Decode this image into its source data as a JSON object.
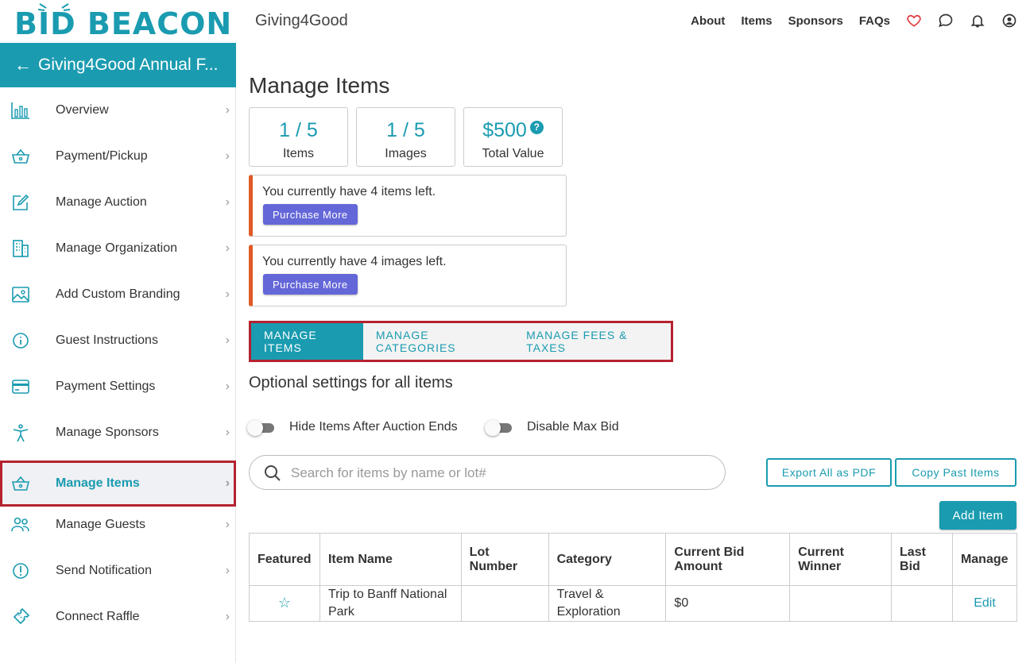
{
  "brand": {
    "logo_text": "BID BEACON",
    "accent": "#1a9bb0",
    "alert": "#e05a24",
    "purchase": "#6467d8",
    "highlight": "#b52230"
  },
  "header": {
    "org_name": "Giving4Good",
    "nav": [
      "About",
      "Items",
      "Sponsors",
      "FAQs"
    ],
    "icons": [
      "heart-icon",
      "chat-icon",
      "bell-icon",
      "account-icon"
    ]
  },
  "sidebar": {
    "back_title": "Giving4Good Annual F...",
    "items": [
      {
        "label": "Overview",
        "icon": "bar-chart-icon"
      },
      {
        "label": "Payment/Pickup",
        "icon": "basket-icon"
      },
      {
        "label": "Manage Auction",
        "icon": "edit-icon"
      },
      {
        "label": "Manage Organization",
        "icon": "building-icon"
      },
      {
        "label": "Add Custom Branding",
        "icon": "image-icon"
      },
      {
        "label": "Guest Instructions",
        "icon": "info-icon"
      },
      {
        "label": "Payment Settings",
        "icon": "credit-card-icon"
      },
      {
        "label": "Manage Sponsors",
        "icon": "person-icon"
      },
      {
        "label": "Manage Items",
        "icon": "basket-icon",
        "active": true
      },
      {
        "label": "Manage Guests",
        "icon": "users-icon"
      },
      {
        "label": "Send Notification",
        "icon": "alert-icon"
      },
      {
        "label": "Connect Raffle",
        "icon": "ticket-icon"
      }
    ]
  },
  "main": {
    "title": "Manage Items",
    "stats": [
      {
        "value": "1 / 5",
        "caption": "Items"
      },
      {
        "value": "1 / 5",
        "caption": "Images"
      },
      {
        "value": "$500",
        "caption": "Total Value",
        "help": "?"
      }
    ],
    "alerts": [
      {
        "message": "You currently have 4 items left.",
        "button": "Purchase More"
      },
      {
        "message": "You currently have 4 images left.",
        "button": "Purchase More"
      }
    ],
    "tabs": [
      "MANAGE ITEMS",
      "MANAGE CATEGORIES",
      "MANAGE FEES & TAXES"
    ],
    "optional_title": "Optional settings for all items",
    "toggles": [
      {
        "label": "Hide Items After Auction Ends",
        "on": false
      },
      {
        "label": "Disable Max Bid",
        "on": false
      }
    ],
    "search_placeholder": "Search for items by name or lot#",
    "export_button": "Export All as PDF",
    "copy_button": "Copy Past Items",
    "add_button": "Add Item",
    "table": {
      "headers": [
        "Featured",
        "Item Name",
        "Lot Number",
        "Category",
        "Current Bid Amount",
        "Current Winner",
        "Last Bid",
        "Manage"
      ],
      "rows": [
        {
          "featured": "☆",
          "name": "Trip to Banff National Park",
          "lot": "",
          "category": "Travel & Exploration",
          "bid": "$0",
          "winner": "",
          "last_bid": "",
          "manage": "Edit"
        }
      ]
    }
  }
}
